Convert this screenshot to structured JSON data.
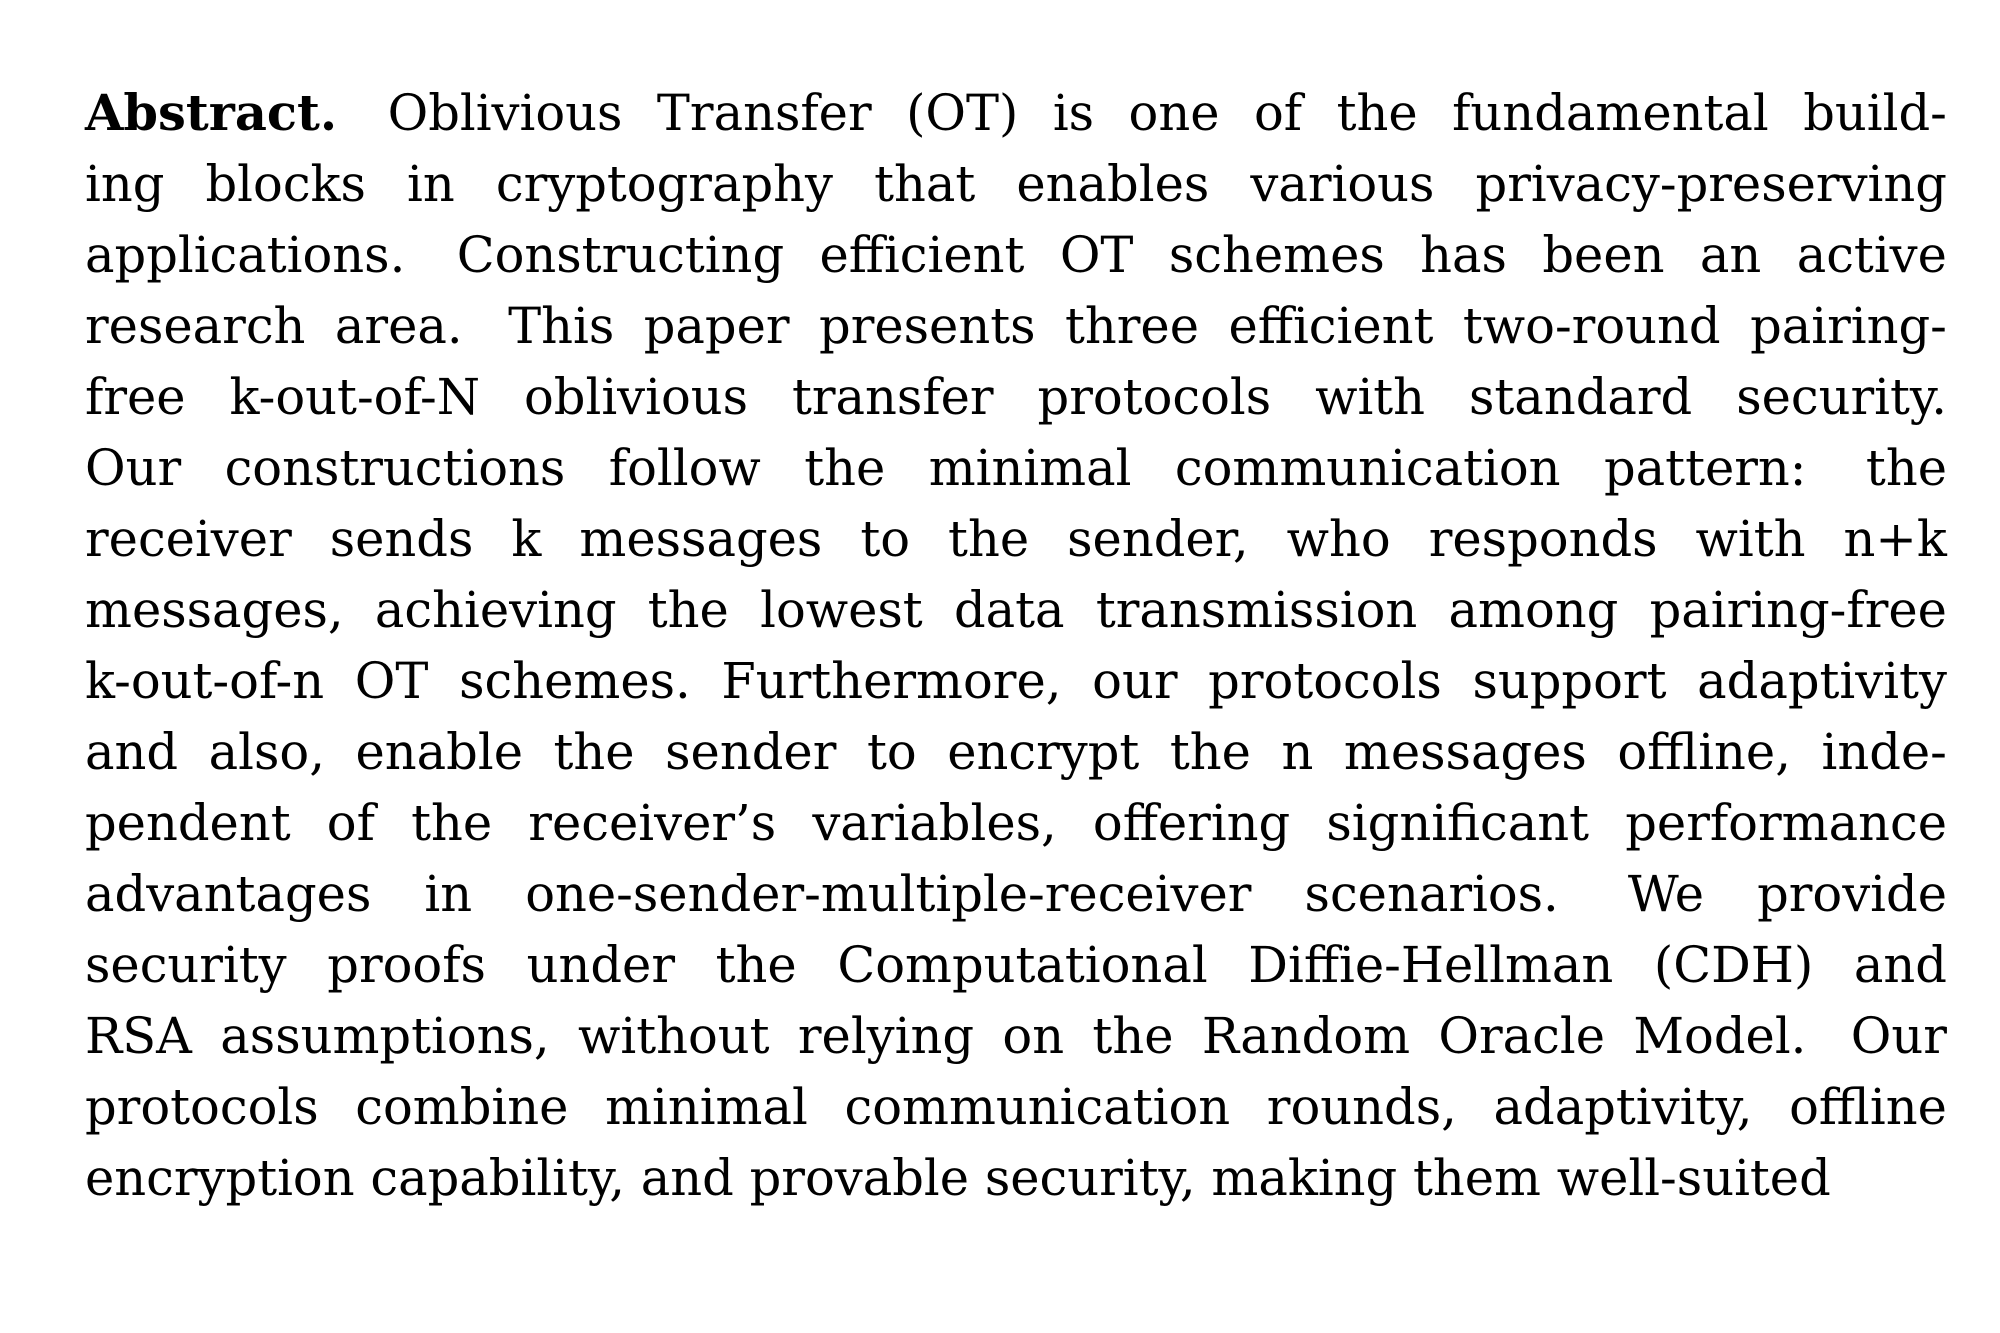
{
  "document": {
    "type": "paper-abstract",
    "background_color": "#ffffff",
    "text_color": "#000000",
    "section_label": "Abstract.",
    "alignment": "justified",
    "lines": [
      "Abstract.  Oblivious Transfer (OT) is one of the fundamental build-",
      "ing blocks in cryptography that enables various privacy-preserving",
      "applications.  Constructing efficient OT schemes has been an active",
      "research area.  This paper presents three efficient two-round pairing-",
      "free k-out-of-N oblivious transfer protocols with standard security.",
      "Our constructions follow the minimal communication pattern:  the",
      "receiver sends k messages to the sender, who responds with n+k",
      "messages, achieving the lowest data transmission among pairing-free",
      "k-out-of-n OT schemes. Furthermore, our protocols support adaptivity",
      "and also, enable the sender to encrypt the n messages offline, inde-",
      "pendent of the receiver’s variables, offering significant performance",
      "advantages in one-sender-multiple-receiver scenarios.  We provide",
      "security proofs under the Computational Diffie-Hellman (CDH) and",
      "RSA assumptions, without relying on the Random Oracle Model.  Our",
      "protocols combine minimal communication rounds, adaptivity, offline",
      "encryption capability, and provable security, making them well-suited"
    ],
    "full_text": "Abstract. Oblivious Transfer (OT) is one of the fundamental building blocks in cryptography that enables various privacy-preserving applications. Constructing efficient OT schemes has been an active research area. This paper presents three efficient two-round pairing-free k-out-of-N oblivious transfer protocols with standard security. Our constructions follow the minimal communication pattern: the receiver sends k messages to the sender, who responds with n+k messages, achieving the lowest data transmission among pairing-free k-out-of-n OT schemes. Furthermore, our protocols support adaptivity and also, enable the sender to encrypt the n messages offline, independent of the receiver’s variables, offering significant performance advantages in one-sender-multiple-receiver scenarios. We provide security proofs under the Computational Diffie-Hellman (CDH) and RSA assumptions, without relying on the Random Oracle Model. Our protocols combine minimal communication rounds, adaptivity, offline encryption capability, and provable security, making them well-suited"
  }
}
